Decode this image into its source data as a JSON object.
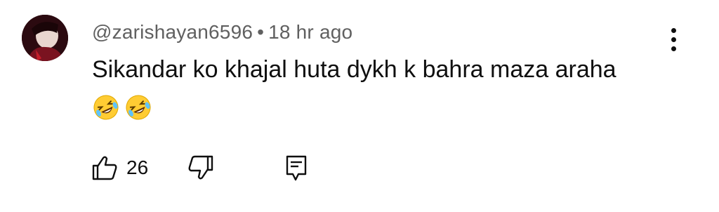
{
  "comment": {
    "author": "@zarishayan6596",
    "separator": "•",
    "timestamp": "18 hr ago",
    "text": "Sikandar ko khajal huta dykh k bahra maza araha",
    "emojis": [
      "rolling-on-floor-laughing-emoji",
      "rolling-on-floor-laughing-emoji"
    ],
    "likes": "26"
  },
  "icons": {
    "like": "thumb-up-icon",
    "dislike": "thumb-down-icon",
    "reply": "comment-reply-icon",
    "menu": "more-vertical-icon"
  },
  "colors": {
    "meta": "#606060",
    "text": "#0f0f0f",
    "emoji_face": "#ffcc33"
  }
}
